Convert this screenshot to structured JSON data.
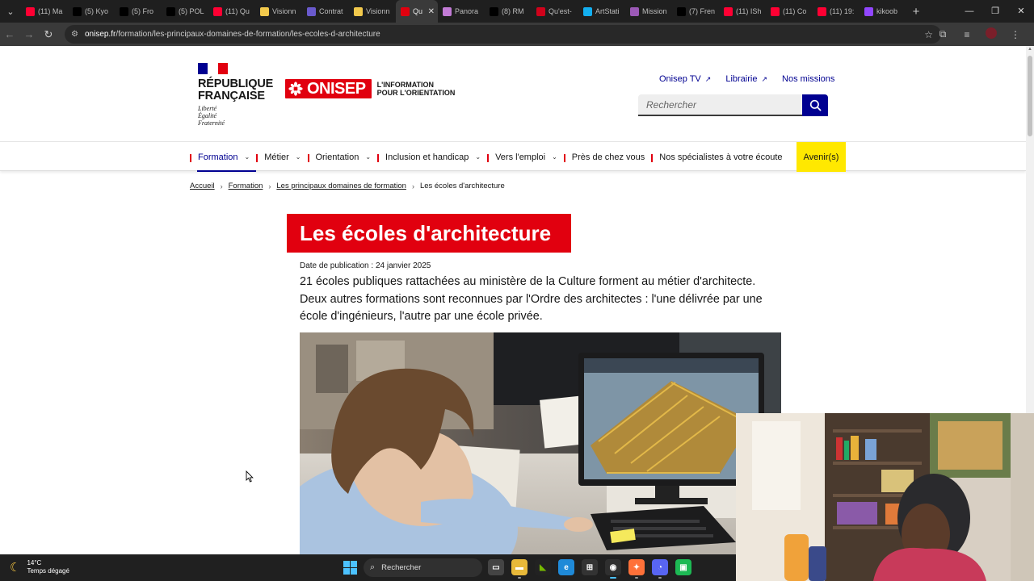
{
  "browser": {
    "tabs": [
      {
        "label": "(11) Ma",
        "icon": "youtube-icon",
        "color": "#ff0033"
      },
      {
        "label": "(5) Kyo",
        "icon": "x-icon",
        "color": "#000000"
      },
      {
        "label": "(5) Fro",
        "icon": "x-icon",
        "color": "#000000"
      },
      {
        "label": "(5) POL",
        "icon": "x-icon",
        "color": "#000000"
      },
      {
        "label": "(11) Qu",
        "icon": "youtube-icon",
        "color": "#ff0033"
      },
      {
        "label": "Visionn",
        "icon": "emoji-icon",
        "color": "#f2c94c"
      },
      {
        "label": "Contrat",
        "icon": "person-icon",
        "color": "#6a5acd"
      },
      {
        "label": "Visionn",
        "icon": "emoji-icon",
        "color": "#f2c94c"
      },
      {
        "label": "Qu",
        "icon": "onisep-icon",
        "color": "#e1000f",
        "active": true
      },
      {
        "label": "Panora",
        "icon": "panorama-icon",
        "color": "#c27bd6"
      },
      {
        "label": "(8) RM",
        "icon": "x-icon",
        "color": "#000000"
      },
      {
        "label": "Qu'est-",
        "icon": "letudiant-icon",
        "color": "#d0021b"
      },
      {
        "label": "ArtStati",
        "icon": "artstation-icon",
        "color": "#13aff0"
      },
      {
        "label": "Mission",
        "icon": "slack-icon",
        "color": "#9b59b6"
      },
      {
        "label": "(7) Fren",
        "icon": "x-icon",
        "color": "#000000"
      },
      {
        "label": "(11) ISh",
        "icon": "youtube-icon",
        "color": "#ff0033"
      },
      {
        "label": "(11) Co",
        "icon": "youtube-icon",
        "color": "#ff0033"
      },
      {
        "label": "(11) 19:",
        "icon": "youtube-icon",
        "color": "#ff0033"
      },
      {
        "label": "kikoob",
        "icon": "twitch-icon",
        "color": "#9146ff"
      }
    ],
    "url_domain": "onisep.fr",
    "url_path": "/formation/les-principaux-domaines-de-formation/les-ecoles-d-architecture"
  },
  "header": {
    "republic_line1": "RÉPUBLIQUE",
    "republic_line2": "FRANÇAISE",
    "motto": [
      "Liberté",
      "Égalité",
      "Fraternité"
    ],
    "brand": "ONISEP",
    "tagline_line1": "L'INFORMATION",
    "tagline_line2": "POUR L'ORIENTATION",
    "top_links": [
      "Onisep TV",
      "Librairie",
      "Nos missions"
    ],
    "search_placeholder": "Rechercher"
  },
  "nav": [
    {
      "label": "Formation",
      "dropdown": true,
      "current": true
    },
    {
      "label": "Métier",
      "dropdown": true
    },
    {
      "label": "Orientation",
      "dropdown": true
    },
    {
      "label": "Inclusion et handicap",
      "dropdown": true
    },
    {
      "label": "Vers l'emploi",
      "dropdown": true
    },
    {
      "label": "Près de chez vous",
      "dropdown": false
    },
    {
      "label": "Nos spécialistes à votre écoute",
      "dropdown": false
    },
    {
      "label": "Avenir(s)",
      "dropdown": false,
      "highlight": "#ffe800"
    }
  ],
  "breadcrumb": [
    "Accueil",
    "Formation",
    "Les principaux domaines de formation",
    "Les écoles d'architecture"
  ],
  "article": {
    "title": "Les écoles d'architecture",
    "pub_date": "Date de publication : 24 janvier 2025",
    "chapo": "21 écoles publiques rattachées au ministère de la Culture forment au métier d'architecte. Deux autres formations sont reconnues par l'Ordre des architectes : l'une délivrée par une école d'ingénieurs, l'autre par une école privée."
  },
  "taskbar": {
    "temperature": "14°C",
    "weather": "Temps dégagé",
    "search_label": "Rechercher"
  },
  "colors": {
    "onisep_red": "#e1000f",
    "dsfr_blue": "#000091",
    "avenir_yellow": "#ffe800"
  }
}
